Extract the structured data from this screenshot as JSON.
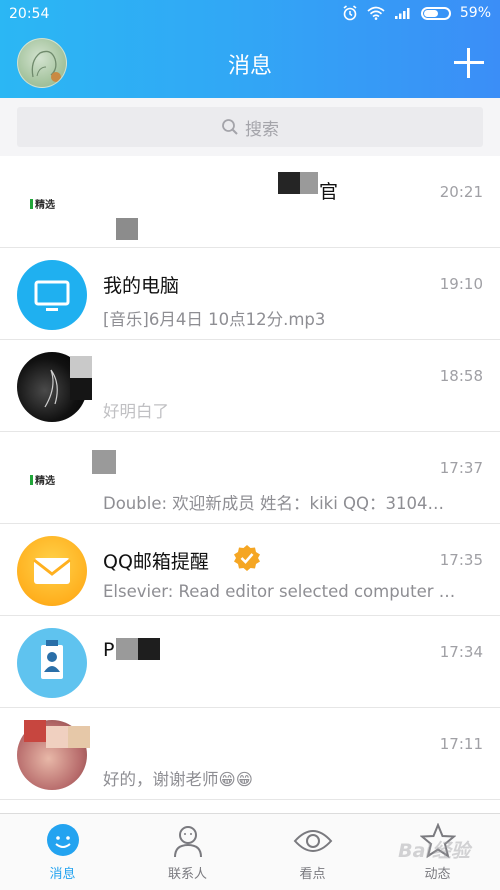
{
  "status_bar": {
    "time": "20:54",
    "battery": "59%",
    "battery_level": 0.59
  },
  "header": {
    "title": "消息",
    "add_icon": "plus-icon"
  },
  "search": {
    "placeholder": "搜索",
    "icon": "search-icon"
  },
  "conversations": [
    {
      "name": "官",
      "tag": "精选",
      "message": "",
      "time": "20:21"
    },
    {
      "name": "我的电脑",
      "message": "[音乐]6月4日 10点12分.mp3",
      "time": "19:10"
    },
    {
      "name": "",
      "message": "好明白了",
      "time": "18:58"
    },
    {
      "name": "",
      "tag": "精选",
      "message": "Double: 欢迎新成员 姓名：kiki QQ：3104…",
      "time": "17:37"
    },
    {
      "name": "QQ邮箱提醒",
      "message": "Elsevier: Read editor selected computer …",
      "time": "17:35"
    },
    {
      "name": "P",
      "message": "",
      "time": "17:34"
    },
    {
      "name": "",
      "message": "好的，谢谢老师😁😁",
      "time": "17:11"
    }
  ],
  "tabs": [
    {
      "label": "消息",
      "icon": "chat-bubble-icon",
      "active": true
    },
    {
      "label": "联系人",
      "icon": "contacts-icon",
      "active": false
    },
    {
      "label": "看点",
      "icon": "eye-icon",
      "active": false
    },
    {
      "label": "动态",
      "icon": "star-icon",
      "active": false
    }
  ],
  "watermark": "Bai经验",
  "colors": {
    "accent": "#23a3f0",
    "header_start": "#2bb7f4",
    "header_end": "#3b8ef7"
  }
}
